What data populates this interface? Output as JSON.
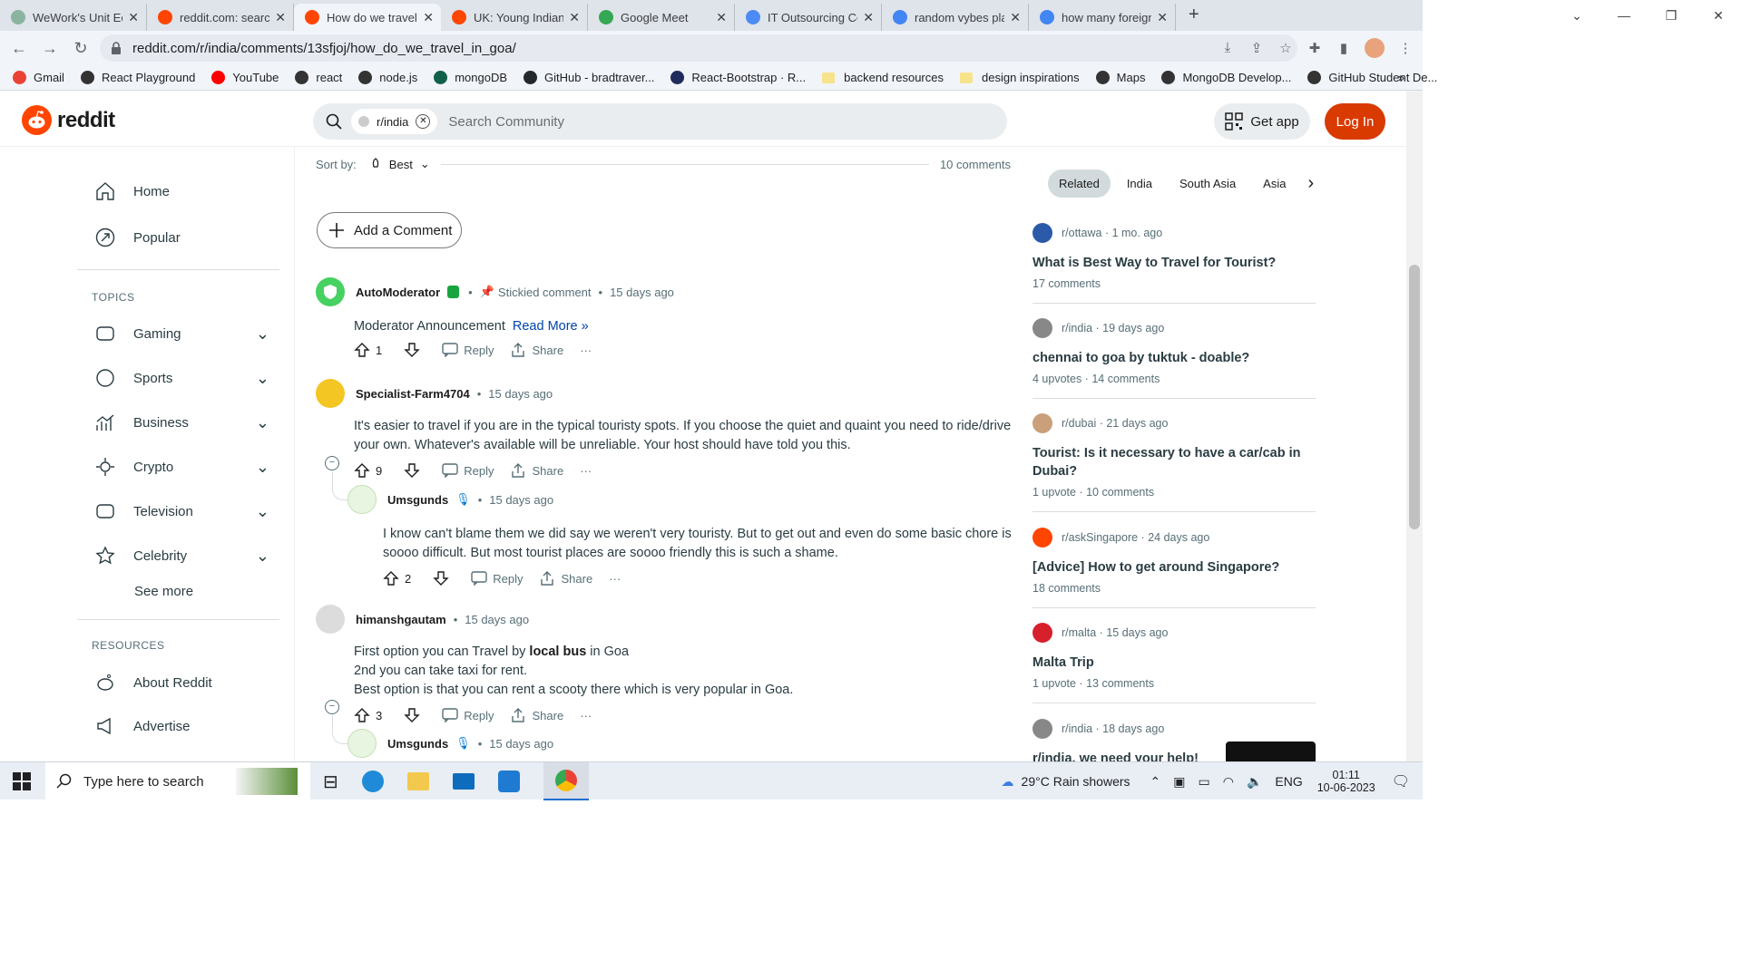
{
  "browser": {
    "tabs": [
      {
        "title": "WeWork's Unit Ec",
        "color": "#8ab4a0"
      },
      {
        "title": "reddit.com: searc",
        "color": "#ff4500"
      },
      {
        "title": "How do we travel",
        "color": "#ff4500",
        "active": true
      },
      {
        "title": "UK: Young Indian",
        "color": "#ff4500"
      },
      {
        "title": "Google Meet",
        "color": "#34a853"
      },
      {
        "title": "IT Outsourcing Co",
        "color": "#4c8bf5"
      },
      {
        "title": "random vybes pla",
        "color": "#4285f4"
      },
      {
        "title": "how many foreign",
        "color": "#4285f4"
      }
    ],
    "new_tab": "+",
    "url": "reddit.com/r/india/comments/13sfjoj/how_do_we_travel_in_goa/",
    "bookmarks": [
      {
        "label": "Gmail",
        "color": "#ea4335"
      },
      {
        "label": "React Playground",
        "color": "#333333"
      },
      {
        "label": "YouTube",
        "color": "#ff0000"
      },
      {
        "label": "react",
        "color": "#333333"
      },
      {
        "label": "node.js",
        "color": "#333333"
      },
      {
        "label": "mongoDB",
        "color": "#116149"
      },
      {
        "label": "GitHub - bradtraver...",
        "color": "#24292e"
      },
      {
        "label": "React-Bootstrap · R...",
        "color": "#1f2b5c"
      },
      {
        "label": "backend resources",
        "folder": true
      },
      {
        "label": "design inspirations",
        "folder": true
      },
      {
        "label": "Maps",
        "color": "#333333"
      },
      {
        "label": "MongoDB Develop...",
        "color": "#333333"
      },
      {
        "label": "GitHub Student De...",
        "color": "#333333"
      }
    ],
    "bookmarks_more": "»"
  },
  "header": {
    "logo": "reddit",
    "search_chip": "r/india",
    "search_placeholder": "Search Community",
    "get_app": "Get app",
    "login": "Log In"
  },
  "leftnav": {
    "home": "Home",
    "popular": "Popular",
    "topics_heading": "TOPICS",
    "topics": [
      "Gaming",
      "Sports",
      "Business",
      "Crypto",
      "Television",
      "Celebrity"
    ],
    "see_more": "See more",
    "resources_heading": "RESOURCES",
    "about": "About Reddit",
    "advertise": "Advertise"
  },
  "main": {
    "sort_label": "Sort by:",
    "sort_value": "Best",
    "comment_count": "10 comments",
    "add_comment": "Add a Comment",
    "comments": [
      {
        "author": "AutoModerator",
        "stickied": "Stickied comment",
        "time": "15 days ago",
        "body": "Moderator Announcement",
        "read_more": "Read More »",
        "votes": "1",
        "reply": "Reply",
        "share": "Share",
        "more": "···"
      },
      {
        "author": "Specialist-Farm4704",
        "time": "15 days ago",
        "body": "It's easier to travel if you are in the typical touristy spots. If you choose the quiet and quaint you need to ride/drive your own. Whatever's available will be unreliable. Your host should have told you this.",
        "votes": "9",
        "reply": "Reply",
        "share": "Share",
        "more": "···"
      },
      {
        "author": "Umsgunds",
        "time": "15 days ago",
        "body": "I know can't blame them we did say we weren't very touristy. But to get out and even do some basic chore is soooo difficult. But most tourist places are soooo friendly this is such a shame.",
        "votes": "2",
        "reply": "Reply",
        "share": "Share",
        "more": "···"
      },
      {
        "author": "himanshgautam",
        "time": "15 days ago",
        "line1_pre": "First option you can Travel by ",
        "line1_bold": "local bus",
        "line1_post": " in Goa",
        "line2": "2nd you can take taxi for rent.",
        "line3": "Best option is that you can rent a scooty there which is very popular in Goa.",
        "votes": "3",
        "reply": "Reply",
        "share": "Share",
        "more": "···"
      },
      {
        "author": "Umsgunds",
        "time": "15 days ago"
      }
    ]
  },
  "sidebar": {
    "tabs": [
      "Related",
      "India",
      "South Asia",
      "Asia"
    ],
    "posts": [
      {
        "sub": "r/ottawa",
        "time": "1 mo. ago",
        "title": "What is Best Way to Travel for Tourist?",
        "stats": "17 comments",
        "color": "#2b5aa8"
      },
      {
        "sub": "r/india",
        "time": "19 days ago",
        "title": "chennai to goa by tuktuk - doable?",
        "stats": "4 upvotes · 14 comments",
        "color": "#888888"
      },
      {
        "sub": "r/dubai",
        "time": "21 days ago",
        "title": "Tourist: Is it necessary to have a car/cab in Dubai?",
        "stats": "1 upvote · 10 comments",
        "color": "#c9a07a"
      },
      {
        "sub": "r/askSingapore",
        "time": "24 days ago",
        "title": "[Advice] How to get around Singapore?",
        "stats": "18 comments",
        "color": "#ff4500"
      },
      {
        "sub": "r/malta",
        "time": "15 days ago",
        "title": "Malta Trip",
        "stats": "1 upvote · 13 comments",
        "color": "#d6202c"
      },
      {
        "sub": "r/india",
        "time": "18 days ago",
        "title": "r/india, we need your help!",
        "stats": "",
        "color": "#888888"
      }
    ]
  },
  "taskbar": {
    "search_placeholder": "Type here to search",
    "weather": "29°C  Rain showers",
    "lang": "ENG",
    "time": "01:11",
    "date": "10-06-2023"
  }
}
